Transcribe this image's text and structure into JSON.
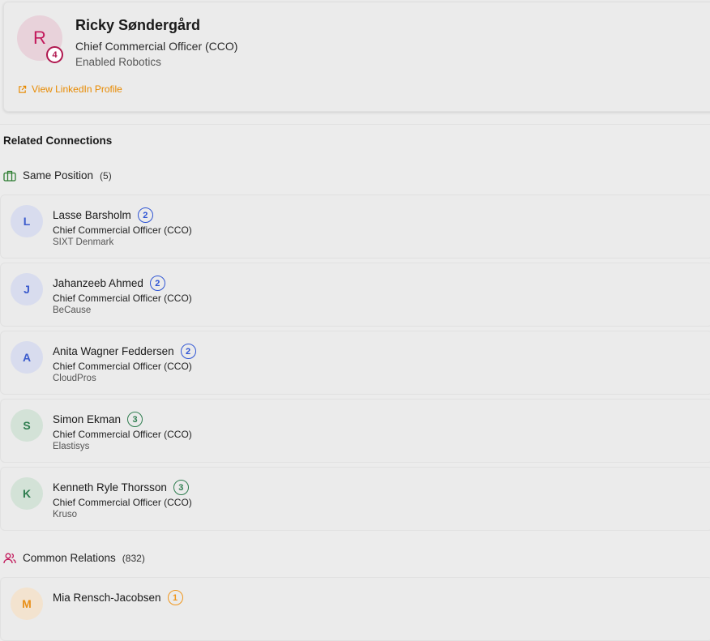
{
  "profile": {
    "initial": "R",
    "degree": "4",
    "name": "Ricky Søndergård",
    "title": "Chief Commercial Officer (CCO)",
    "company": "Enabled Robotics",
    "linkedin_label": "View LinkedIn Profile",
    "link_icon": "external-link-icon"
  },
  "related": {
    "title": "Related Connections",
    "same_position": {
      "label": "Same Position",
      "count": "(5)",
      "icon": "briefcase-icon",
      "color": "#2e7d32"
    },
    "common_relations": {
      "label": "Common Relations",
      "count": "(832)",
      "icon": "users-icon",
      "color": "#c2185b"
    }
  },
  "connections": [
    {
      "initial": "L",
      "name": "Lasse Barsholm",
      "degree": "2",
      "title": "Chief Commercial Officer (CCO)",
      "company": "SIXT Denmark",
      "avatar_bg": "#d8dcee",
      "avatar_fg": "#3b5bcc",
      "badge_color": "#2f55d4"
    },
    {
      "initial": "J",
      "name": "Jahanzeeb Ahmed",
      "degree": "2",
      "title": "Chief Commercial Officer (CCO)",
      "company": "BeCause",
      "avatar_bg": "#d8dcee",
      "avatar_fg": "#3b5bcc",
      "badge_color": "#2f55d4"
    },
    {
      "initial": "A",
      "name": "Anita Wagner Feddersen",
      "degree": "2",
      "title": "Chief Commercial Officer (CCO)",
      "company": "CloudPros",
      "avatar_bg": "#d8dcee",
      "avatar_fg": "#3b5bcc",
      "badge_color": "#2f55d4"
    },
    {
      "initial": "S",
      "name": "Simon Ekman",
      "degree": "3",
      "title": "Chief Commercial Officer (CCO)",
      "company": "Elastisys",
      "avatar_bg": "#d3e2d7",
      "avatar_fg": "#2e7d4f",
      "badge_color": "#2e7d4f"
    },
    {
      "initial": "K",
      "name": "Kenneth Ryle Thorsson",
      "degree": "3",
      "title": "Chief Commercial Officer (CCO)",
      "company": "Kruso",
      "avatar_bg": "#d3e2d7",
      "avatar_fg": "#2e7d4f",
      "badge_color": "#2e7d4f"
    }
  ],
  "common_connections": [
    {
      "initial": "M",
      "name": "Mia Rensch-Jacobsen",
      "degree": "1",
      "avatar_bg": "#f3e3cf",
      "avatar_fg": "#e8901a",
      "badge_color": "#f0961c"
    }
  ]
}
